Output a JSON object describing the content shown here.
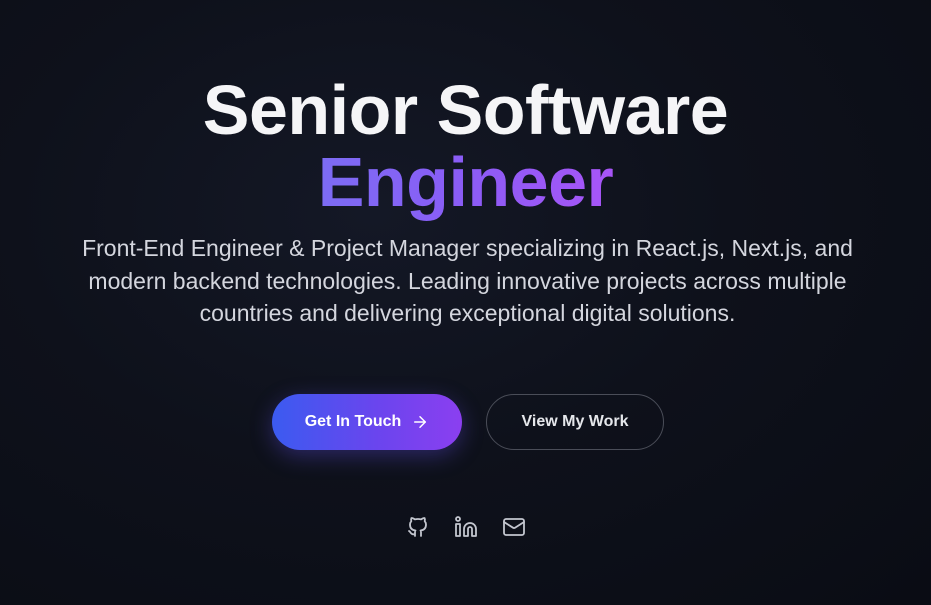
{
  "hero": {
    "title_line1": "Senior Software",
    "title_line2": "Engineer",
    "subtitle": "Front-End Engineer & Project Manager specializing in React.js, Next.js, and modern backend technologies. Leading innovative projects across multiple countries and delivering exceptional digital solutions.",
    "primary_button": {
      "label": "Get In Touch",
      "icon": "arrow-right-icon"
    },
    "secondary_button": {
      "label": "View My Work"
    },
    "socials": [
      {
        "icon": "github-icon"
      },
      {
        "icon": "linkedin-icon"
      },
      {
        "icon": "mail-icon"
      }
    ]
  },
  "colors": {
    "background": "#0e111b",
    "title": "#f5f5f7",
    "accent_gradient_start": "#3b5bf0",
    "accent_gradient_end": "#8b3ff0",
    "highlight_text": "#8b5cf6",
    "subtitle": "#d4d6de"
  }
}
